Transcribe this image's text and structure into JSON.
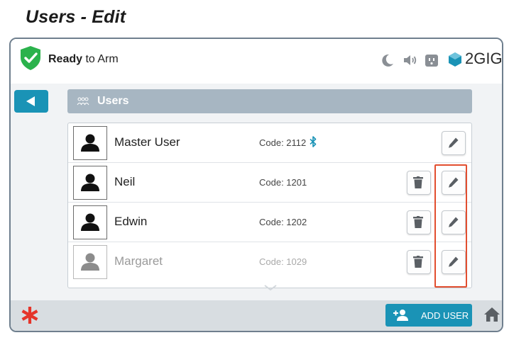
{
  "page_heading": "Users - Edit",
  "status": {
    "bold": "Ready",
    "rest": " to Arm"
  },
  "status_icons": [
    "moon-icon",
    "speaker-icon",
    "outlet-icon"
  ],
  "brand": "2GIG",
  "users_header": "Users",
  "users": [
    {
      "name": "Master User",
      "code": "Code: 2112",
      "bluetooth": true,
      "deletable": false,
      "enabled": true
    },
    {
      "name": "Neil",
      "code": "Code: 1201",
      "bluetooth": false,
      "deletable": true,
      "enabled": true
    },
    {
      "name": "Edwin",
      "code": "Code: 1202",
      "bluetooth": false,
      "deletable": true,
      "enabled": true
    },
    {
      "name": "Margaret",
      "code": "Code: 1029",
      "bluetooth": false,
      "deletable": true,
      "enabled": false
    }
  ],
  "add_user_label": "ADD USER",
  "colors": {
    "accent": "#1a93b6",
    "highlight": "#e24e2f",
    "ready_green": "#2bb24c",
    "emergency": "#e5342a"
  }
}
